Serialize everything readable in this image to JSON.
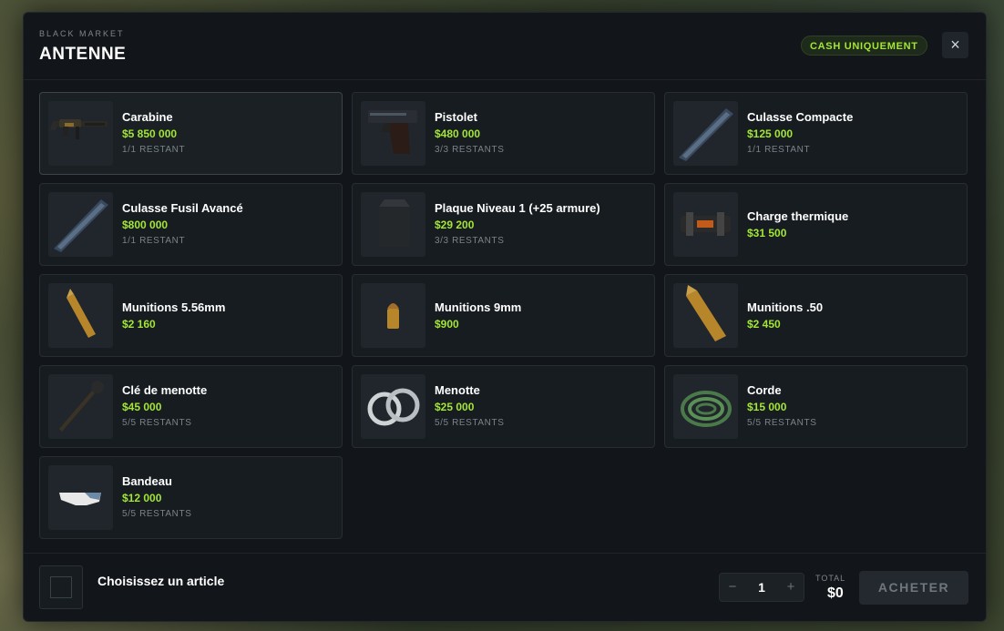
{
  "header": {
    "kicker": "BLACK MARKET",
    "title": "ANTENNE",
    "badge": "CASH UNIQUEMENT",
    "close_icon": "close-icon"
  },
  "items": [
    {
      "name": "Carabine",
      "price": "$5 850 000",
      "stock": "1/1 RESTANT",
      "icon": "rifle-icon",
      "selected": true
    },
    {
      "name": "Pistolet",
      "price": "$480 000",
      "stock": "3/3 RESTANTS",
      "icon": "pistol-icon"
    },
    {
      "name": "Culasse Compacte",
      "price": "$125 000",
      "stock": "1/1 RESTANT",
      "icon": "weapon-part-icon"
    },
    {
      "name": "Culasse Fusil Avancé",
      "price": "$800 000",
      "stock": "1/1 RESTANT",
      "icon": "weapon-part-icon"
    },
    {
      "name": "Plaque Niveau 1 (+25 armure)",
      "price": "$29 200",
      "stock": "3/3 RESTANTS",
      "icon": "armor-plate-icon"
    },
    {
      "name": "Charge thermique",
      "price": "$31 500",
      "stock": "",
      "icon": "thermal-charge-icon"
    },
    {
      "name": "Munitions 5.56mm",
      "price": "$2 160",
      "stock": "",
      "icon": "bullet-icon"
    },
    {
      "name": "Munitions 9mm",
      "price": "$900",
      "stock": "",
      "icon": "bullet-small-icon"
    },
    {
      "name": "Munitions .50",
      "price": "$2 450",
      "stock": "",
      "icon": "bullet-icon"
    },
    {
      "name": "Clé de menotte",
      "price": "$45 000",
      "stock": "5/5 RESTANTS",
      "icon": "handcuff-key-icon"
    },
    {
      "name": "Menotte",
      "price": "$25 000",
      "stock": "5/5 RESTANTS",
      "icon": "handcuffs-icon"
    },
    {
      "name": "Corde",
      "price": "$15 000",
      "stock": "5/5 RESTANTS",
      "icon": "rope-icon"
    },
    {
      "name": "Bandeau",
      "price": "$12 000",
      "stock": "5/5 RESTANTS",
      "icon": "blindfold-icon"
    }
  ],
  "footer": {
    "selection_label": "Choisissez un article",
    "quantity": "1",
    "minus": "−",
    "plus": "+",
    "total_label": "TOTAL",
    "total_value": "$0",
    "buy_label": "ACHETER"
  },
  "colors": {
    "accent": "#a3e635",
    "background": "#12161a"
  }
}
